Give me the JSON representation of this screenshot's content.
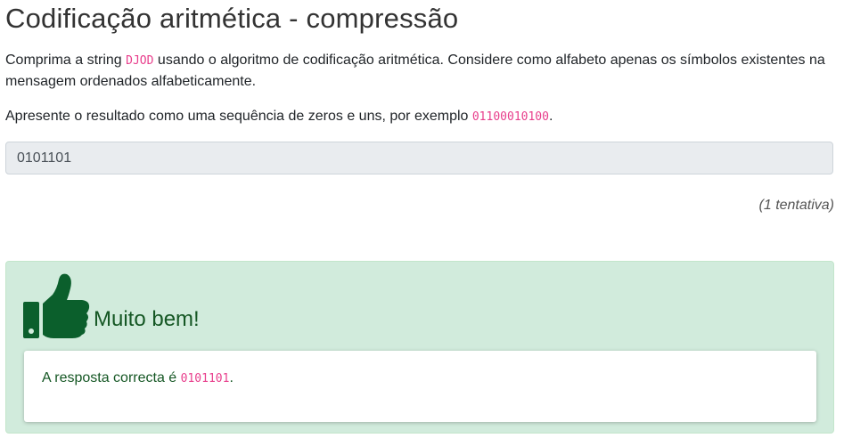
{
  "page": {
    "title": "Codificação aritmética - compressão"
  },
  "question": {
    "p1_before": "Comprima a string ",
    "string_code": "DJOD",
    "p1_after": " usando o algoritmo de codificação aritmética. Considere como alfabeto apenas os símbolos existentes na mensagem ordenados alfabeticamente.",
    "p2_before": "Apresente o resultado como uma sequência de zeros e uns, por exemplo ",
    "example_code": "01100010100",
    "p2_after": "."
  },
  "answer_input": {
    "value": "0101101"
  },
  "attempts_text": "(1 tentativa)",
  "feedback": {
    "icon": "thumbs-up-icon",
    "heading": "Muito bem!",
    "correct_before": "A resposta correcta é ",
    "correct_code": "0101101",
    "correct_after": "."
  },
  "colors": {
    "success_bg": "#d1ebdc",
    "success_text": "#155724",
    "icon_green": "#0b5f2c",
    "code_pink": "#e83e8c",
    "input_bg": "#e9ecef"
  }
}
